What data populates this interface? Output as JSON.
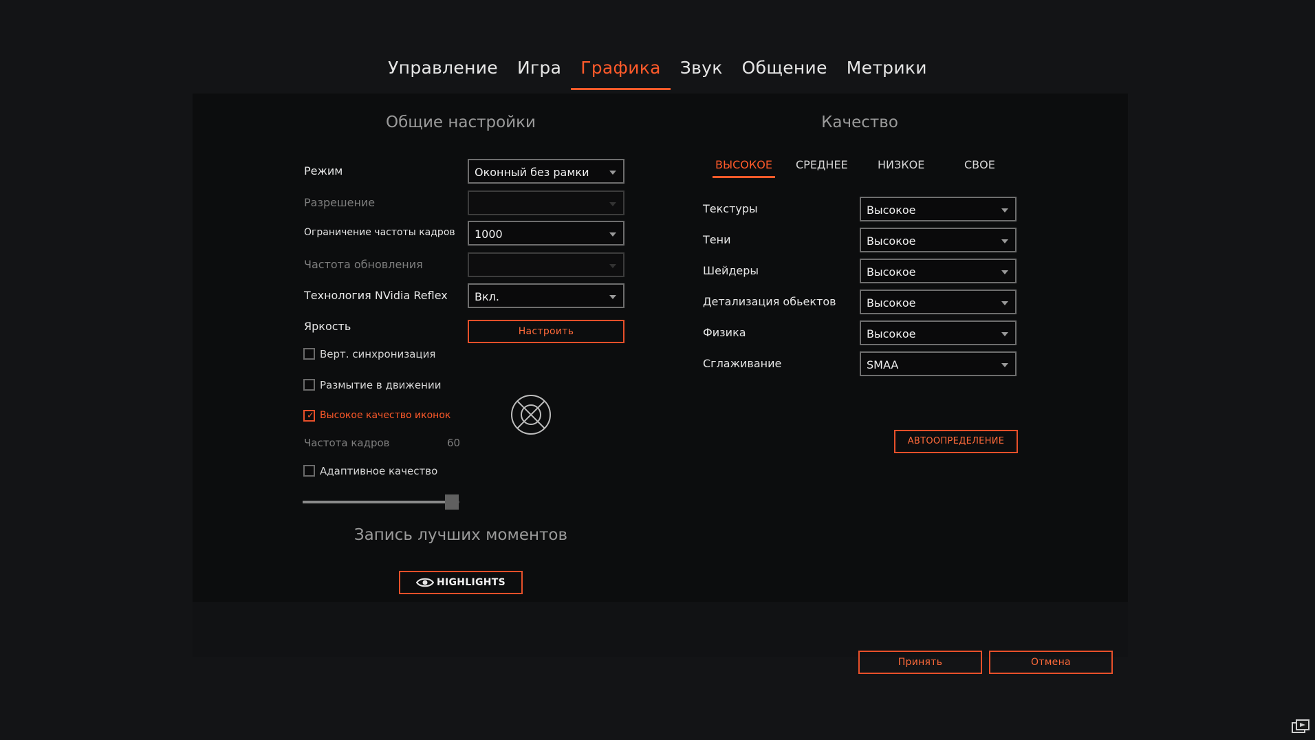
{
  "tabs": [
    "Управление",
    "Игра",
    "Графика",
    "Звук",
    "Общение",
    "Метрики"
  ],
  "active_tab_index": 2,
  "general": {
    "title": "Общие настройки",
    "mode_label": "Режим",
    "mode_value": "Оконный без рамки",
    "resolution_label": "Разрешение",
    "resolution_value": "",
    "fps_limit_label": "Ограничение частоты кадров",
    "fps_limit_value": "1000",
    "refresh_label": "Частота обновления",
    "refresh_value": "",
    "reflex_label": "Технология NVidia Reflex",
    "reflex_value": "Вкл.",
    "brightness_label": "Яркость",
    "brightness_button": "Настроить",
    "vsync_label": "Верт. синхронизация",
    "vsync_checked": false,
    "motion_blur_label": "Размытие в движении",
    "motion_blur_checked": false,
    "hq_icons_label": "Высокое качество иконок",
    "hq_icons_checked": true,
    "framerate_label": "Частота кадров",
    "framerate_value": "60",
    "adaptive_label": "Адаптивное качество",
    "adaptive_checked": false,
    "slider_fraction": 0.95
  },
  "highlights": {
    "title": "Запись лучших моментов",
    "button_label": "HIGHLIGHTS"
  },
  "quality": {
    "title": "Качество",
    "presets": [
      "ВЫСОКОЕ",
      "СРЕДНЕЕ",
      "НИЗКОЕ",
      "СВОЕ"
    ],
    "active_preset_index": 0,
    "textures_label": "Текстуры",
    "textures_value": "Высокое",
    "shadows_label": "Тени",
    "shadows_value": "Высокое",
    "shaders_label": "Шейдеры",
    "shaders_value": "Высокое",
    "detail_label": "Детализация обьектов",
    "detail_value": "Высокое",
    "physics_label": "Физика",
    "physics_value": "Высокое",
    "aa_label": "Сглаживание",
    "aa_value": "SMAA",
    "autodetect_button": "АВТООПРЕДЕЛЕНИЕ"
  },
  "footer": {
    "accept_label": "Принять",
    "cancel_label": "Отмена"
  },
  "colors": {
    "accent": "#ff5a2a",
    "background": "#131416",
    "panel": "#0c0d0e"
  }
}
